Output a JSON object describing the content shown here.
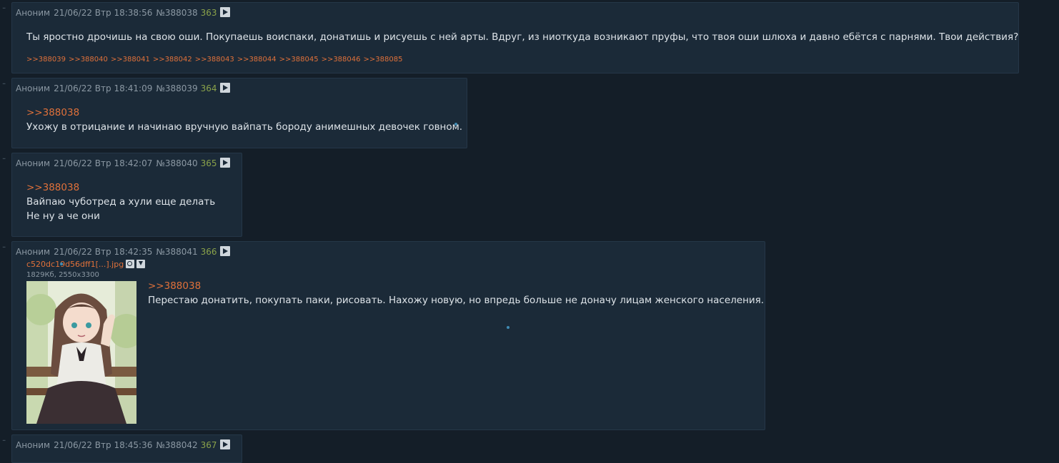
{
  "posts": [
    {
      "author": "Аноним",
      "date": "21/06/22 Втр 18:38:56",
      "id": "№388038",
      "num": "363",
      "lines": [
        "Ты яростно дрочишь на свою оши. Покупаешь воиспаки, донатишь и рисуешь с ней арты. Вдруг, из ниоткуда возникают пруфы, что твоя оши шлюха и давно ебётся с парнями. Твои действия?"
      ],
      "replies": [
        ">>388039",
        ">>388040",
        ">>388041",
        ">>388042",
        ">>388043",
        ">>388044",
        ">>388045",
        ">>388046",
        ">>388085"
      ]
    },
    {
      "author": "Аноним",
      "date": "21/06/22 Втр 18:41:09",
      "id": "№388039",
      "num": "364",
      "reply_to": ">>388038",
      "lines": [
        "Ухожу в отрицание и начинаю вручную вайпать бороду анимешных девочек говном."
      ]
    },
    {
      "author": "Аноним",
      "date": "21/06/22 Втр 18:42:07",
      "id": "№388040",
      "num": "365",
      "reply_to": ">>388038",
      "lines": [
        "Вайпаю чуботред а хули еще делать",
        "Не ну а че они"
      ]
    },
    {
      "author": "Аноним",
      "date": "21/06/22 Втр 18:42:35",
      "id": "№388041",
      "num": "366",
      "file_name": "c520dc19d56dff1[...].jpg",
      "file_meta": "1829Кб, 2550x3300",
      "reply_to": ">>388038",
      "lines": [
        "Перестаю донатить, покупать паки, рисовать. Нахожу новую, но впредь больше не доначу лицам женского населения."
      ]
    },
    {
      "author": "Аноним",
      "date": "21/06/22 Втр 18:45:36",
      "id": "№388042",
      "num": "367"
    }
  ]
}
